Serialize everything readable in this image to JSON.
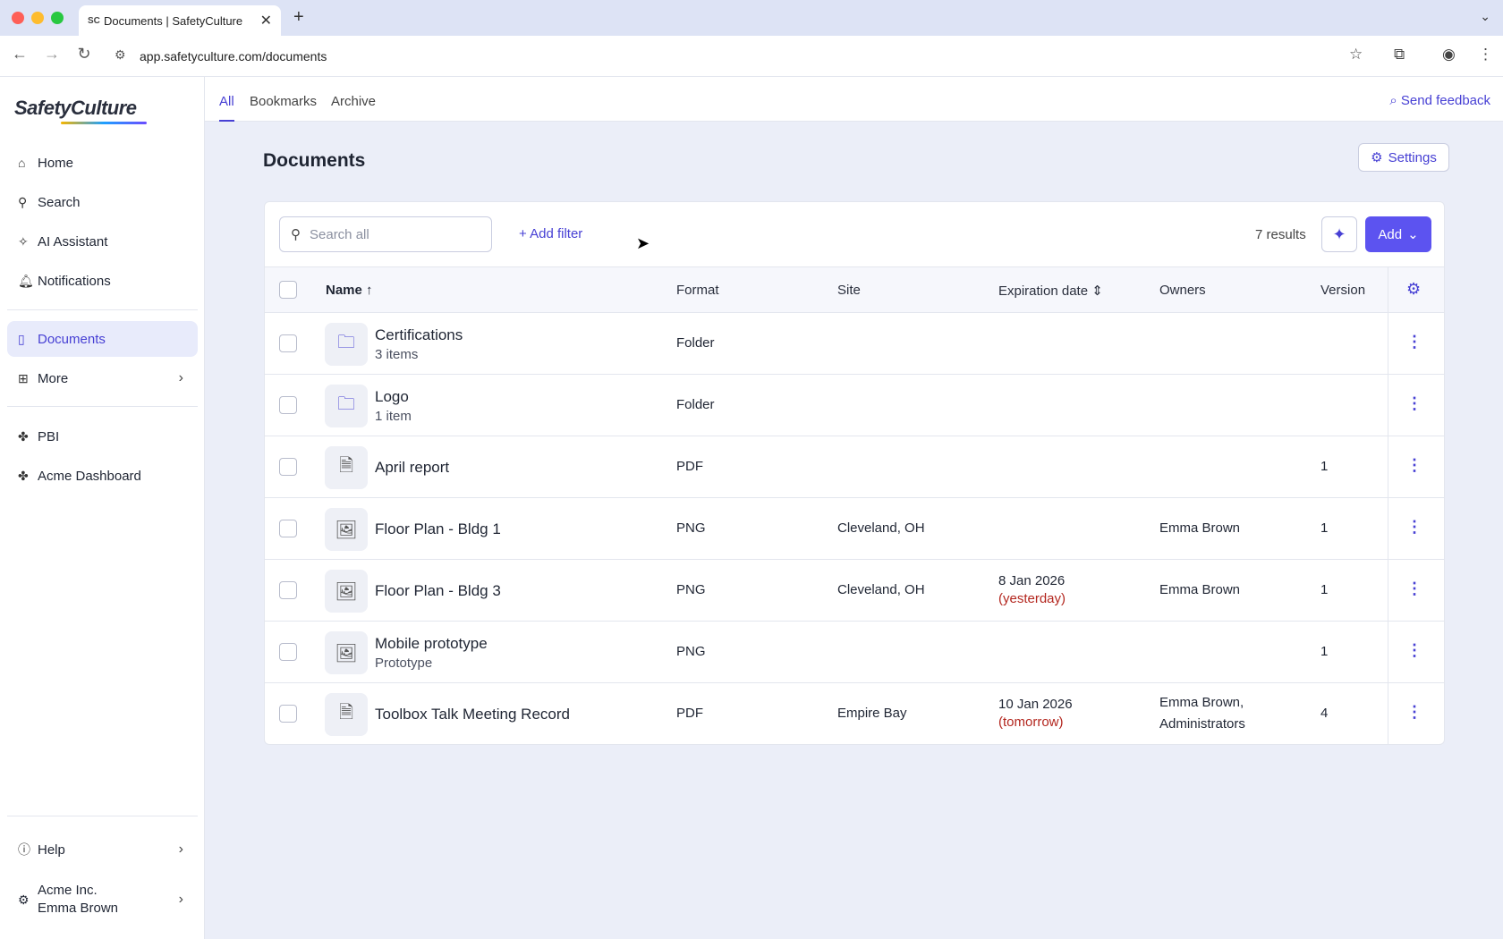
{
  "browser": {
    "tab_title": "Documents | SafetyCulture",
    "tab_favicon": "SC",
    "url": "app.safetyculture.com/documents"
  },
  "sidebar": {
    "logo": "SafetyCulture",
    "items": [
      {
        "label": "Home",
        "icon": "home-icon"
      },
      {
        "label": "Search",
        "icon": "search-icon"
      },
      {
        "label": "AI Assistant",
        "icon": "sparkle-icon"
      },
      {
        "label": "Notifications",
        "icon": "bell-icon"
      },
      {
        "label": "Documents",
        "icon": "document-icon"
      },
      {
        "label": "More",
        "icon": "grid-icon"
      },
      {
        "label": "PBI",
        "icon": "puzzle-icon"
      },
      {
        "label": "Acme Dashboard",
        "icon": "puzzle-icon"
      }
    ],
    "help": "Help",
    "org": "Acme Inc.",
    "user": "Emma Brown"
  },
  "top_tabs": {
    "all": "All",
    "bookmarks": "Bookmarks",
    "archive": "Archive",
    "feedback": "Send feedback"
  },
  "main": {
    "title": "Documents",
    "settings": "Settings",
    "search_placeholder": "Search all",
    "add_filter": "Add filter",
    "results": "7 results",
    "add": "Add",
    "columns": {
      "name": "Name",
      "format": "Format",
      "site": "Site",
      "expiration": "Expiration date",
      "owners": "Owners",
      "version": "Version"
    },
    "rows": [
      {
        "name": "Certifications",
        "sub": "3 items",
        "format": "Folder",
        "site": "",
        "exp": "",
        "exp_note": "",
        "owners": "",
        "owners2": "",
        "version": ""
      },
      {
        "name": "Logo",
        "sub": "1 item",
        "format": "Folder",
        "site": "",
        "exp": "",
        "exp_note": "",
        "owners": "",
        "owners2": "",
        "version": ""
      },
      {
        "name": "April report",
        "sub": "",
        "format": "PDF",
        "site": "",
        "exp": "",
        "exp_note": "",
        "owners": "",
        "owners2": "",
        "version": "1"
      },
      {
        "name": "Floor Plan - Bldg 1",
        "sub": "",
        "format": "PNG",
        "site": "Cleveland, OH",
        "exp": "",
        "exp_note": "",
        "owners": "Emma Brown",
        "owners2": "",
        "version": "1"
      },
      {
        "name": "Floor Plan - Bldg 3",
        "sub": "",
        "format": "PNG",
        "site": "Cleveland, OH",
        "exp": "8 Jan 2026",
        "exp_note": "(yesterday)",
        "owners": "Emma Brown",
        "owners2": "",
        "version": "1"
      },
      {
        "name": "Mobile prototype",
        "sub": "Prototype",
        "format": "PNG",
        "site": "",
        "exp": "",
        "exp_note": "",
        "owners": "",
        "owners2": "",
        "version": "1"
      },
      {
        "name": "Toolbox Talk Meeting Record",
        "sub": "",
        "format": "PDF",
        "site": "Empire Bay",
        "exp": "10 Jan 2026",
        "exp_note": "(tomorrow)",
        "owners": "Emma Brown,",
        "owners2": "Administrators",
        "version": "4"
      }
    ]
  },
  "colors": {
    "accent": "#4740d4",
    "primary_button": "#5c53f0",
    "overdue": "#b3261e",
    "page_bg": "#ebeef8"
  }
}
